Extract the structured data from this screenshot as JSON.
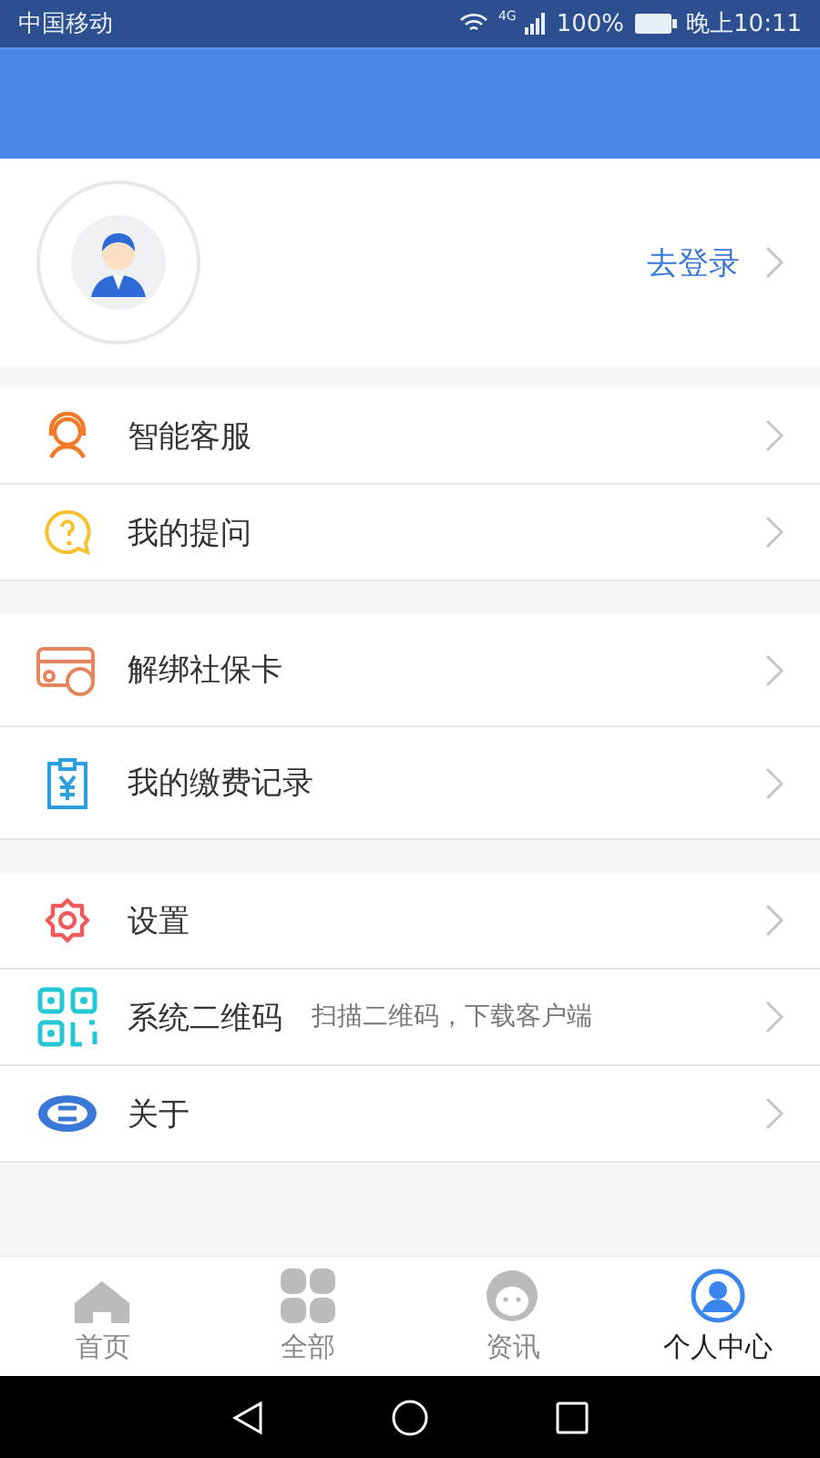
{
  "status_bar": {
    "carrier": "中国移动",
    "network": "4G",
    "battery": "100%",
    "time": "晚上10:11"
  },
  "profile": {
    "login": "去登录"
  },
  "menu_groups": [
    {
      "items": [
        {
          "label": "智能客服"
        },
        {
          "label": "我的提问"
        }
      ]
    },
    {
      "items": [
        {
          "label": "解绑社保卡"
        },
        {
          "label": "我的缴费记录"
        }
      ]
    },
    {
      "items": [
        {
          "label": "设置"
        },
        {
          "label": "系统二维码",
          "hint": "扫描二维码，下载客户端"
        },
        {
          "label": "关于"
        }
      ]
    }
  ],
  "tabs": [
    {
      "label": "首页",
      "selected": false
    },
    {
      "label": "全部",
      "selected": false
    },
    {
      "label": "资讯",
      "selected": false
    },
    {
      "label": "个人中心",
      "selected": true
    }
  ]
}
